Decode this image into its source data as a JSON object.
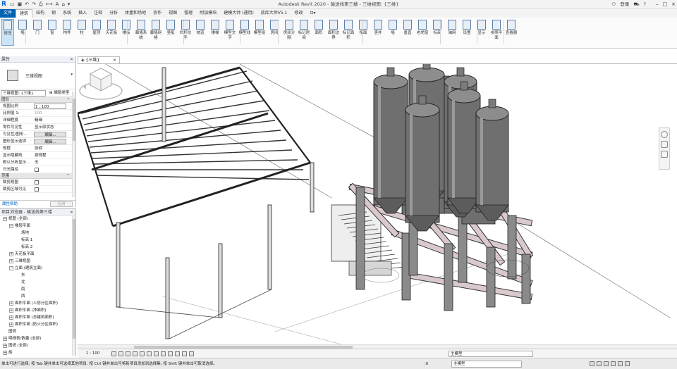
{
  "titlebar": {
    "title": "Autodesk Revit 2020 - 输送线第三楼 - 三维视图: {三维}",
    "search_placeholder": "",
    "login": "登录",
    "help": "?"
  },
  "tabs": [
    "文件",
    "建筑",
    "结构",
    "钢",
    "系统",
    "插入",
    "注释",
    "分析",
    "体量和场地",
    "协作",
    "视图",
    "管理",
    "附加模块",
    "建模大师 (通用)",
    "族库大师V5.1",
    "修改",
    "⊡▾"
  ],
  "ribbon": {
    "buttons": [
      "修改",
      "墙",
      "门",
      "窗",
      "构件",
      "柱",
      "屋顶",
      "天花板",
      "楼板",
      "幕墙系统",
      "幕墙网格",
      "竖梃",
      "栏杆扶手",
      "坡道",
      "楼梯",
      "模型文字",
      "模型线",
      "模型组",
      "房间",
      "房间分隔",
      "标记房间",
      "面积",
      "面积边界",
      "标记面积",
      "按面",
      "竖井",
      "墙",
      "垂直",
      "老虎窗",
      "标高",
      "轴网",
      "设置",
      "显示",
      "参照平面",
      "查看器"
    ],
    "selected": "修改"
  },
  "properties": {
    "header": "属性",
    "close": "×",
    "type_name": "三维视图",
    "view_selector": "三维视图: {三维}",
    "edit_type": "编辑类型",
    "section_graphics": "图形",
    "rows": [
      {
        "k": "视图比例",
        "v": "1 : 100",
        "style": "boxed"
      },
      {
        "k": "比例值 1:",
        "v": "100",
        "style": "gray"
      },
      {
        "k": "详细程度",
        "v": "精细",
        "style": ""
      },
      {
        "k": "零件可见性",
        "v": "显示原状态",
        "style": ""
      },
      {
        "k": "可见性/图形...",
        "v": "编辑...",
        "style": "btn"
      },
      {
        "k": "图形显示选项",
        "v": "编辑...",
        "style": "btn"
      },
      {
        "k": "规程",
        "v": "协调",
        "style": ""
      },
      {
        "k": "显示隐藏线",
        "v": "按规程",
        "style": ""
      },
      {
        "k": "默认分析显示...",
        "v": "无",
        "style": ""
      },
      {
        "k": "日光路径",
        "v": "",
        "style": "check"
      }
    ],
    "section_range": "范围",
    "range_rows": [
      {
        "k": "裁剪视图",
        "v": "",
        "style": "check"
      },
      {
        "k": "裁剪区域可见",
        "v": "",
        "style": "check"
      }
    ],
    "help_link": "属性帮助",
    "apply": "应用"
  },
  "browser": {
    "header": "项目浏览器 - 输送线第三楼",
    "close": "×",
    "nodes": [
      {
        "t": "视图 (全部)",
        "lvl": 0,
        "pm": "−"
      },
      {
        "t": "楼层平面",
        "lvl": 1,
        "pm": "−"
      },
      {
        "t": "场地",
        "lvl": 2,
        "pm": ""
      },
      {
        "t": "标高 1",
        "lvl": 2,
        "pm": ""
      },
      {
        "t": "标高 2",
        "lvl": 2,
        "pm": ""
      },
      {
        "t": "天花板平面",
        "lvl": 1,
        "pm": "+"
      },
      {
        "t": "三维视图",
        "lvl": 1,
        "pm": "+"
      },
      {
        "t": "立面 (建筑立面)",
        "lvl": 1,
        "pm": "−"
      },
      {
        "t": "东",
        "lvl": 2,
        "pm": ""
      },
      {
        "t": "北",
        "lvl": 2,
        "pm": ""
      },
      {
        "t": "南",
        "lvl": 2,
        "pm": ""
      },
      {
        "t": "西",
        "lvl": 2,
        "pm": ""
      },
      {
        "t": "面积平面 (人防分区面积)",
        "lvl": 1,
        "pm": "+"
      },
      {
        "t": "面积平面 (净面积)",
        "lvl": 1,
        "pm": "+"
      },
      {
        "t": "面积平面 (总建筑面积)",
        "lvl": 1,
        "pm": "+"
      },
      {
        "t": "面积平面 (防火分区面积)",
        "lvl": 1,
        "pm": "+"
      },
      {
        "t": "图例",
        "lvl": 0,
        "pm": ""
      },
      {
        "t": "明细表/数量 (全部)",
        "lvl": 0,
        "pm": "+"
      },
      {
        "t": "图纸 (全部)",
        "lvl": 0,
        "pm": "+"
      },
      {
        "t": "族",
        "lvl": 0,
        "pm": "+"
      }
    ]
  },
  "view": {
    "tab_label": "{三维}",
    "tab_close": "×",
    "scale": "1 : 100",
    "model_label": "主模型"
  },
  "status": {
    "message": "单击可进行选择; 按 Tab 键并单击可选择其他项目; 按 Ctrl 键并单击可将新项目添加到选择集; 按 Shift 键并单击可取消选择。",
    "zero": ":0",
    "main_model": "主模型"
  },
  "colors": {
    "accent": "#0063b1",
    "silo": "#6f6f6f",
    "beam": "#d9c9cc"
  }
}
